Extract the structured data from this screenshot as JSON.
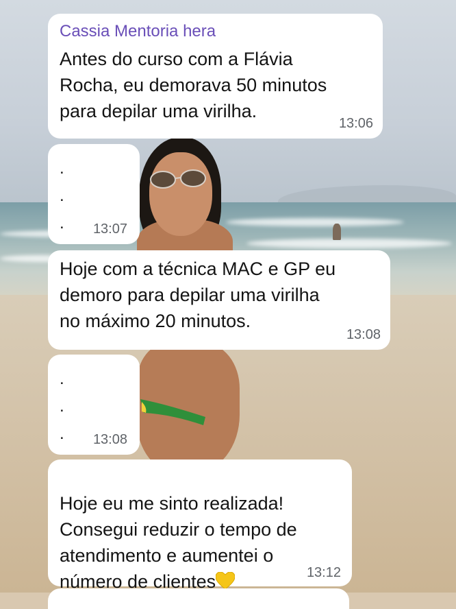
{
  "messages": [
    {
      "sender": "Cassia Mentoria hera",
      "text": "Antes do curso com a Flávia\nRocha, eu demorava 50 minutos\npara depilar uma virilha.",
      "time": "13:06"
    },
    {
      "text": ".\n.\n.",
      "time": "13:07"
    },
    {
      "text": "Hoje com a técnica MAC e GP eu\ndemoro para depilar uma virilha\nno máximo 20 minutos.",
      "time": "13:08"
    },
    {
      "text": ".\n.\n.",
      "time": "13:08"
    },
    {
      "text": "Hoje eu me sinto realizada!\nConsegui reduzir o tempo de\natendimento e aumentei o\nnúmero de clientes",
      "emoji": "yellow-heart-icon",
      "time": "13:12"
    }
  ],
  "colors": {
    "bubble": "#ffffff",
    "sender_name": "#6a4fb8",
    "timestamp": "#5f6368",
    "heart": "#f5c518"
  }
}
